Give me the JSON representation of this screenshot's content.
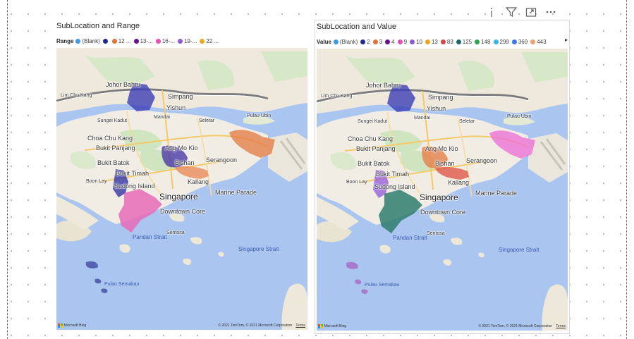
{
  "header_icons": [
    {
      "name": "info-icon"
    },
    {
      "name": "filter-icon"
    },
    {
      "name": "focus-mode-icon"
    },
    {
      "name": "more-options-icon"
    }
  ],
  "visual_left": {
    "title": "SubLocation and Range",
    "legend_title": "Range",
    "legend": [
      {
        "label": "(Blank)",
        "color": "#3b9be8"
      },
      {
        "label": "",
        "color": "#1f2c8e"
      },
      {
        "label": "12 ...",
        "color": "#e0723a"
      },
      {
        "label": "13-...",
        "color": "#6a0f8b"
      },
      {
        "label": "16-...",
        "color": "#e94fb0"
      },
      {
        "label": "19-...",
        "color": "#8c5ccf"
      },
      {
        "label": "22 ...",
        "color": "#f0a51e"
      }
    ]
  },
  "visual_right": {
    "title": "SubLocation and Value",
    "legend_title": "Value",
    "legend": [
      {
        "label": "(Blank)",
        "color": "#3b9be8"
      },
      {
        "label": "2",
        "color": "#1f2c8e"
      },
      {
        "label": "3",
        "color": "#e0723a"
      },
      {
        "label": "4",
        "color": "#6a0f8b"
      },
      {
        "label": "9",
        "color": "#e94fb0"
      },
      {
        "label": "10",
        "color": "#8c5ccf"
      },
      {
        "label": "13",
        "color": "#f0a51e"
      },
      {
        "label": "83",
        "color": "#d9464a"
      },
      {
        "label": "125",
        "color": "#1a6b6b"
      },
      {
        "label": "148",
        "color": "#2da44e"
      },
      {
        "label": "299",
        "color": "#36b7e5"
      },
      {
        "label": "369",
        "color": "#3b7be8"
      },
      {
        "label": "443",
        "color": "#f0a06a"
      }
    ],
    "legend_arrow": "▸"
  },
  "map_labels": {
    "johor_bahru": "Johor Bahru",
    "lim_chu_kang": "Lim Chu Kang",
    "simpang": "Simpang",
    "yishun": "Yishun",
    "mandai": "Mandai",
    "sungei_kadut": "Sungei Kadut",
    "seletar": "Seletar",
    "pulau_ubin": "Pulau Ubin",
    "choa_chu_kang": "Choa Chu Kang",
    "bukit_panjang": "Bukit Panjang",
    "ang_mo_kio": "Ang Mo Kio",
    "serangoon": "Serangoon",
    "bukit_batok": "Bukit Batok",
    "bishan": "Bishan",
    "bukit_timah": "Bukit Timah",
    "boon_lay": "Boon Lay",
    "kallang": "Kallang",
    "sudong_island": "Sudong Island",
    "singapore": "Singapore",
    "marine_parade": "Marine Parade",
    "downtown_core": "Downtown Core",
    "sentosa": "Sentosa",
    "pandan_strait": "Pandan Strait",
    "singapore_strait": "Singapore Strait",
    "pulau_semakau": "Pulau Semakau"
  },
  "map_footer": {
    "provider": "Microsoft Bing",
    "copyright": "© 2021 TomTom, © 2021 Microsoft Corporation",
    "terms": "Terms"
  },
  "region_colors": {
    "north": "#3b3fb5",
    "east": "#e57f4a",
    "east_pink": "#ee73d6",
    "bishan_ang_mo_kio": "#4a3aa8",
    "kallang_orange": "#e88b5a",
    "kallang_red": "#e0584a",
    "west_purple": "#3f3fa8",
    "west_lilac": "#9b6ad8",
    "downtown_pink": "#e76ab8",
    "downtown_teal": "#2f7d6e",
    "islands": "#4d58a8",
    "islands_lilac": "#a872c9"
  }
}
